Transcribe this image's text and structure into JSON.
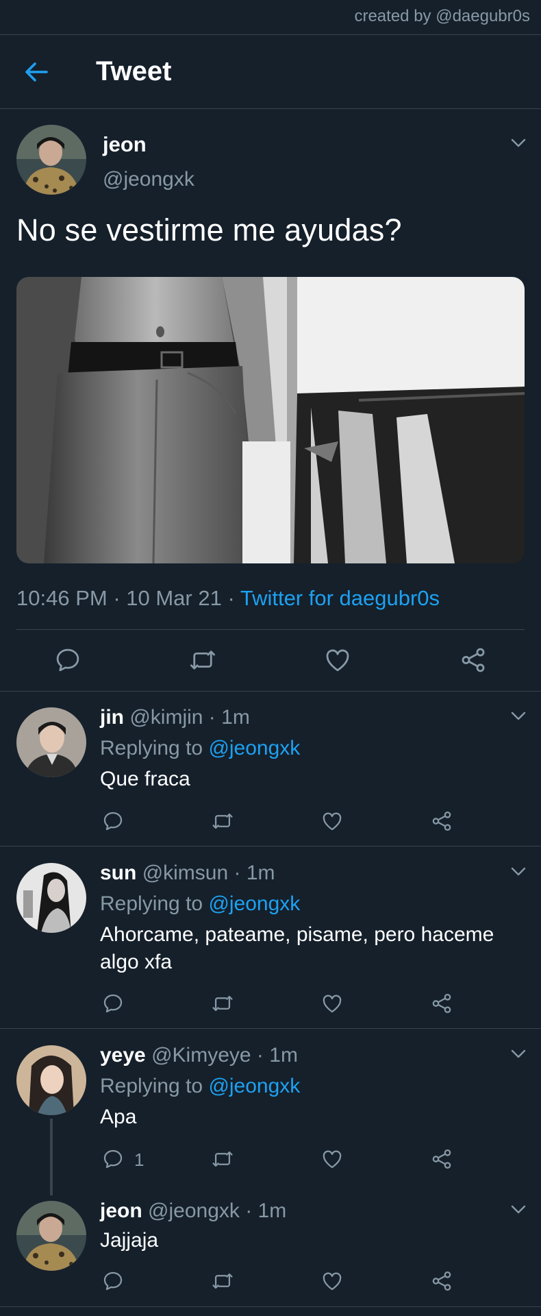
{
  "credit": "created by @daegubr0s",
  "header": {
    "title": "Tweet"
  },
  "tweet": {
    "name": "jeon",
    "handle": "@jeongxk",
    "text": "No se vestirme me ayudas?",
    "time": "10:46 PM",
    "sep1": " · ",
    "date": "10 Mar 21",
    "sep2": " · ",
    "source": "Twitter for daegubr0s"
  },
  "replies": [
    {
      "name": "jin",
      "handle": "@kimjin",
      "dot": " · ",
      "time": "1m",
      "replying_label": "Replying to ",
      "mention": "@jeongxk",
      "text": "Que fraca",
      "reply_count": ""
    },
    {
      "name": "sun",
      "handle": "@kimsun",
      "dot": " · ",
      "time": "1m",
      "replying_label": "Replying to ",
      "mention": "@jeongxk",
      "text": "Ahorcame, pateame, pisame, pero haceme algo xfa",
      "reply_count": ""
    },
    {
      "name": "yeye",
      "handle": "@Kimyeye",
      "dot": " · ",
      "time": "1m",
      "replying_label": "Replying to ",
      "mention": "@jeongxk",
      "text": "Apa",
      "reply_count": "1"
    },
    {
      "name": "jeon",
      "handle": "@jeongxk",
      "dot": " · ",
      "time": "1m",
      "text": "Jajjaja",
      "reply_count": ""
    }
  ],
  "icons": [
    "back-arrow-icon",
    "chevron-down-icon",
    "reply-icon",
    "retweet-icon",
    "like-icon",
    "share-icon"
  ],
  "colors": {
    "background": "#15202b",
    "accent": "#1da1f2",
    "secondary_text": "#8899a6",
    "divider": "#38444d"
  }
}
